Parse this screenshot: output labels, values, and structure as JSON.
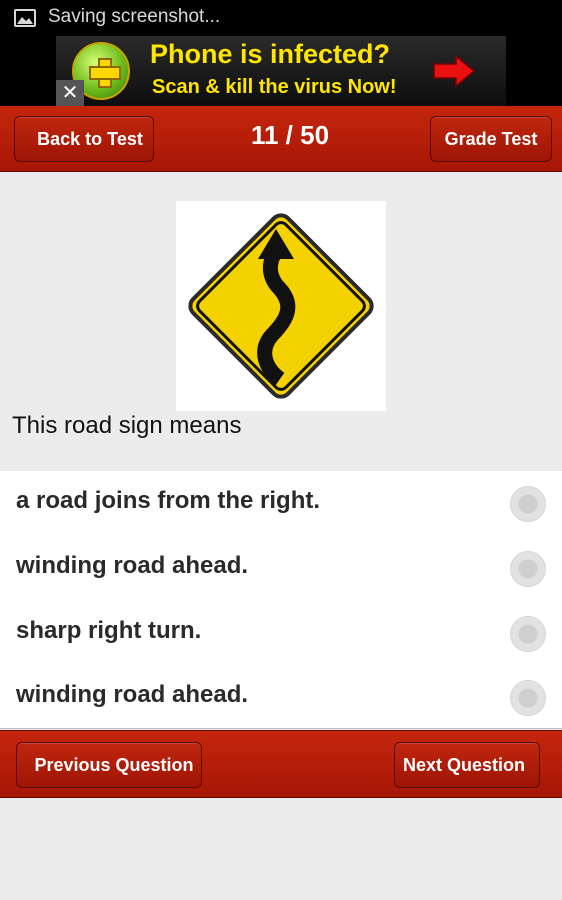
{
  "status_bar": {
    "text": "Saving screenshot...",
    "icon": "image-icon"
  },
  "ad": {
    "title": "Phone is infected?",
    "subtitle": "Scan & kill the virus Now!",
    "close_label": "✕",
    "colors": {
      "text": "#ffe600",
      "arrow": "#e81010"
    }
  },
  "toolbar": {
    "back_label": "Back to Test",
    "counter": "11 / 50",
    "grade_label": "Grade Test"
  },
  "question": {
    "image": "winding-road-sign",
    "text": "This road sign means"
  },
  "answers": [
    {
      "label": "a road joins from the right.",
      "selected": false
    },
    {
      "label": "winding road ahead.",
      "selected": false
    },
    {
      "label": "sharp right turn.",
      "selected": false
    },
    {
      "label": "winding road ahead.",
      "selected": false
    }
  ],
  "navigation": {
    "previous_label": "Previous Question",
    "next_label": "Next Question"
  },
  "colors": {
    "accent": "#b31c08",
    "background": "#ececec"
  }
}
